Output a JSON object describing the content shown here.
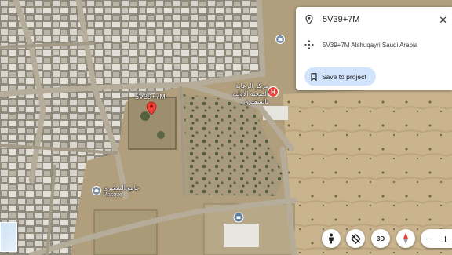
{
  "place_panel": {
    "plus_code": "5V39+7M",
    "full_address": "5V39+7M Alshuqayri Saudi Arabia",
    "save_label": "Save to project",
    "close_glyph": "✕"
  },
  "map": {
    "pin_label": "5V39+7M",
    "places": [
      {
        "name": "مركز الرعاية الصحية الأولية بالشقيري",
        "icon": "hospital-icon"
      },
      {
        "name": "جامع الشقيري",
        "sublabel": "Mosque",
        "icon": "mosque-icon"
      },
      {
        "name": "",
        "icon": "landmark-icon"
      }
    ]
  },
  "controls": {
    "street_view": "pegman-icon",
    "tilt": "tilt-icon",
    "mode_3d": "3D",
    "compass": "compass-icon",
    "zoom_out": "−",
    "zoom_in": "+"
  },
  "colors": {
    "accent": "#1a73e8",
    "save_bg": "#d2e3fc",
    "pin": "#ea4335"
  }
}
